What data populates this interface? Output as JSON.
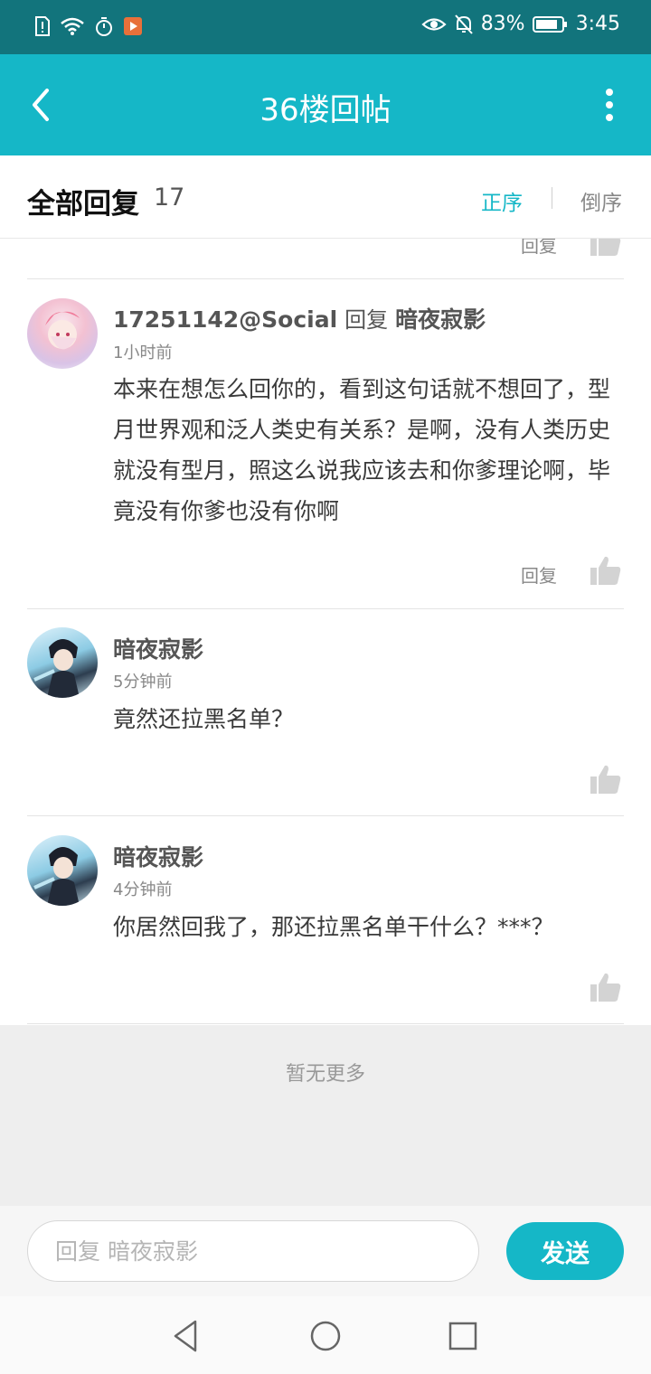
{
  "status_bar": {
    "battery": "83%",
    "time": "3:45",
    "icons": [
      "sim-alert-icon",
      "wifi-icon",
      "timer-icon",
      "video-app-icon",
      "eye-icon",
      "mute-bell-icon",
      "battery-icon"
    ]
  },
  "header": {
    "title": "36楼回帖",
    "back_icon": "chevron-left-icon",
    "more_icon": "more-vertical-icon"
  },
  "section": {
    "title": "全部回复",
    "count": "17",
    "sort_asc": "正序",
    "sort_desc": "倒序"
  },
  "partial_item": {
    "reply_label": "回复"
  },
  "comments": [
    {
      "user": "17251142@Social",
      "reply_word": "回复",
      "reply_to": "暗夜寂影",
      "time": "1小时前",
      "content": "本来在想怎么回你的，看到这句话就不想回了，型月世界观和泛人类史有关系？是啊，没有人类历史就没有型月，照这么说我应该去和你爹理论啊，毕竟没有你爹也没有你啊",
      "reply_label": "回复"
    },
    {
      "user": "暗夜寂影",
      "time": "5分钟前",
      "content": "竟然还拉黑名单？"
    },
    {
      "user": "暗夜寂影",
      "time": "4分钟前",
      "content": "你居然回我了，那还拉黑名单干什么？***？"
    }
  ],
  "footer": {
    "no_more": "暂无更多",
    "input_placeholder": "回复 暗夜寂影",
    "send": "发送"
  },
  "colors": {
    "accent": "#15b7c7",
    "status_bar": "#12747c"
  }
}
